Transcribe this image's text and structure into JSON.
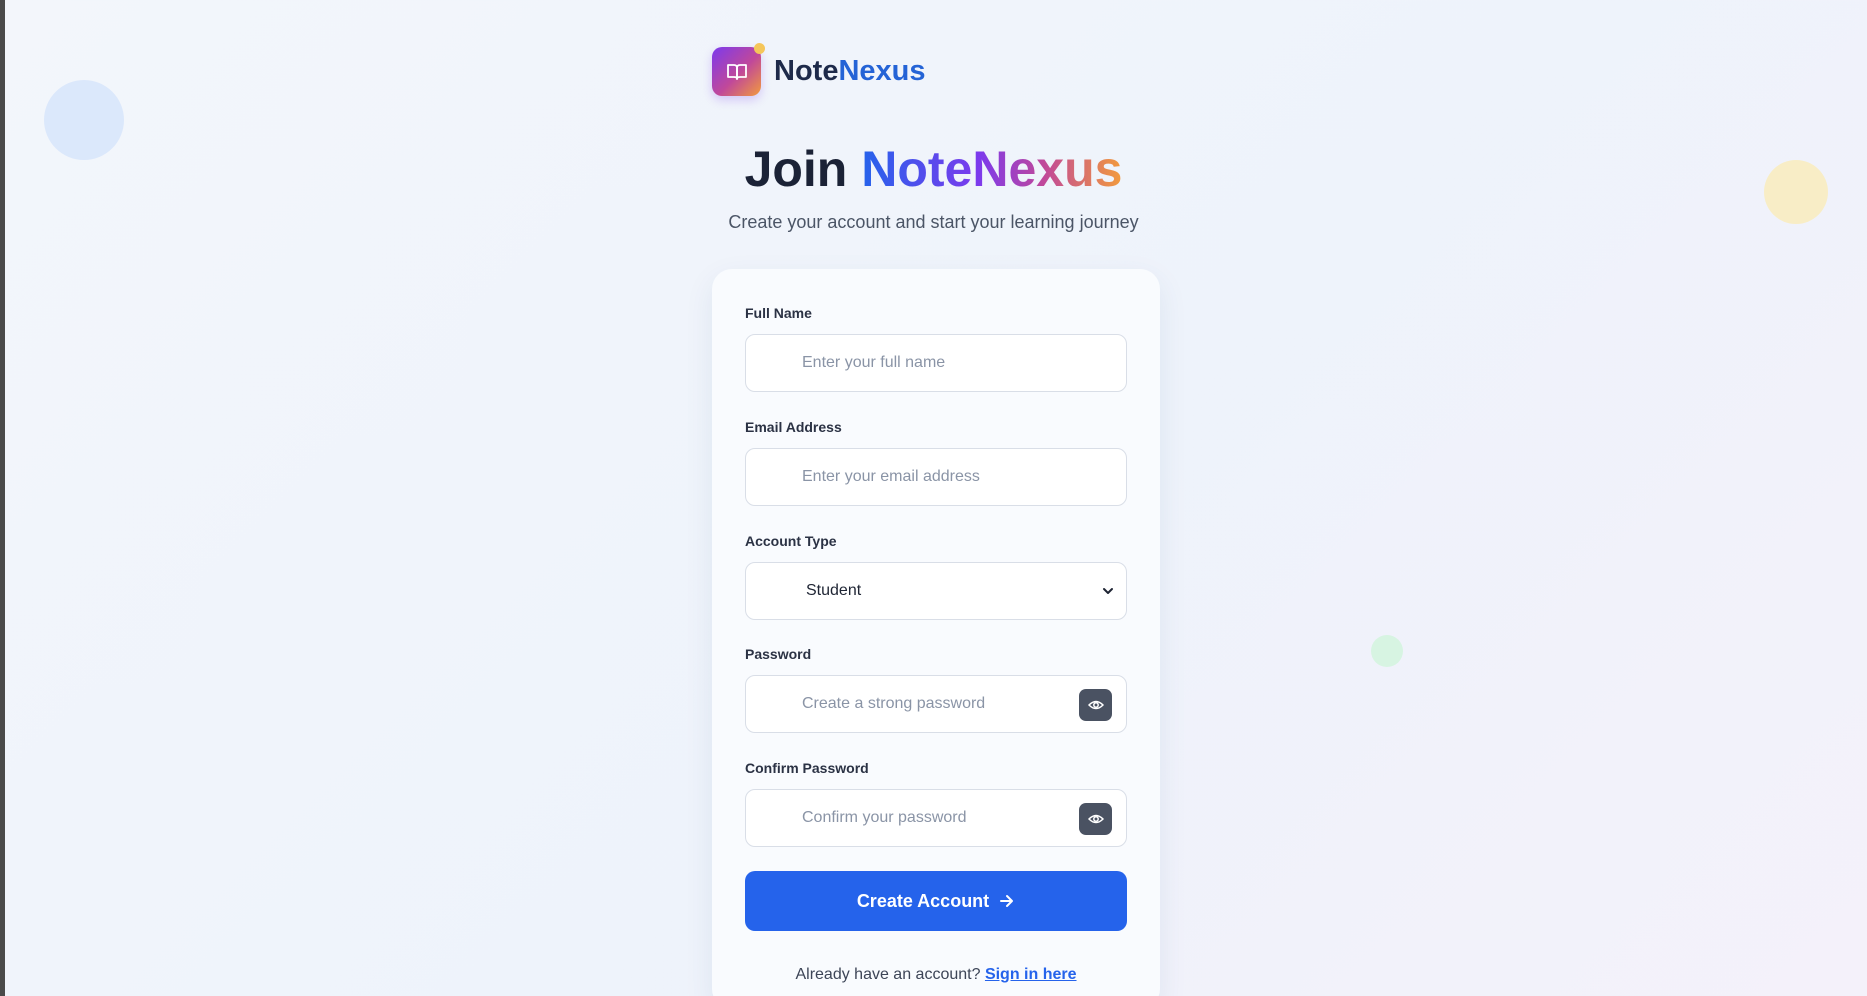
{
  "brand": {
    "name_part1": "Note",
    "name_part2": "Nexus"
  },
  "headline": {
    "prefix": "Join ",
    "highlight": "NoteNexus"
  },
  "subtitle": "Create your account and start your learning journey",
  "form": {
    "full_name": {
      "label": "Full Name",
      "placeholder": "Enter your full name"
    },
    "email": {
      "label": "Email Address",
      "placeholder": "Enter your email address"
    },
    "account_type": {
      "label": "Account Type",
      "selected": "Student"
    },
    "password": {
      "label": "Password",
      "placeholder": "Create a strong password"
    },
    "confirm_password": {
      "label": "Confirm Password",
      "placeholder": "Confirm your password"
    },
    "submit_label": "Create Account",
    "signin_prompt": "Already have an account?",
    "signin_link": "Sign in here"
  },
  "icons": {
    "logo": "book-open-icon",
    "password_toggle": "eye-icon",
    "submit_arrow": "arrow-right-icon",
    "select_chevron": "chevron-down-icon"
  },
  "colors": {
    "primary": "#2563eb",
    "brand_gradient": [
      "#7c3aed",
      "#c0489a",
      "#f29b3c"
    ],
    "eye_button": "#4a5262"
  }
}
